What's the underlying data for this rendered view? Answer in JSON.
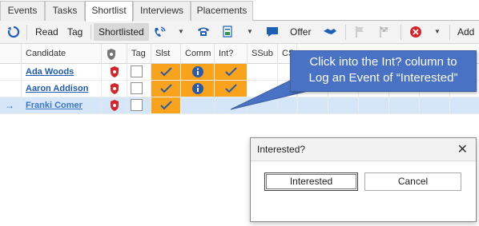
{
  "tabs": [
    {
      "label": "Events",
      "active": false
    },
    {
      "label": "Tasks",
      "active": false
    },
    {
      "label": "Shortlist",
      "active": true
    },
    {
      "label": "Interviews",
      "active": false
    },
    {
      "label": "Placements",
      "active": false
    }
  ],
  "toolbar": {
    "read_label": "Read",
    "tag_label": "Tag",
    "shortlisted_label": "Shortlisted",
    "offer_label": "Offer",
    "add_label": "Add",
    "icons": [
      "refresh-icon",
      "phone-signal-icon",
      "phone-icon",
      "document-icon",
      "chat-icon",
      "offer-icon",
      "handshake-icon",
      "flag-icon",
      "checkered-flag-icon",
      "reject-icon"
    ]
  },
  "grid": {
    "columns": [
      "Candidate",
      "",
      "Tag",
      "Slst",
      "Comm",
      "Int?",
      "SSub",
      "CS"
    ],
    "rows": [
      {
        "name": "Ada Woods",
        "tag": false,
        "slst": true,
        "comm": true,
        "int": true,
        "selected": false
      },
      {
        "name": "Aaron Addison",
        "tag": false,
        "slst": true,
        "comm": true,
        "int": true,
        "selected": false
      },
      {
        "name": "Franki Comer",
        "tag": false,
        "slst": true,
        "comm": false,
        "int": false,
        "selected": true
      }
    ]
  },
  "callout": {
    "line1": "Click into the Int? column to",
    "line2": "Log an Event of “Interested”"
  },
  "dialog": {
    "title": "Interested?",
    "close": "✕",
    "ok_label": "Interested",
    "cancel_label": "Cancel"
  },
  "colors": {
    "accent_orange": "#f9a31c",
    "callout_blue": "#4a72c4",
    "link_blue": "#1f5bb2",
    "selected_row": "#d5e6f9"
  }
}
